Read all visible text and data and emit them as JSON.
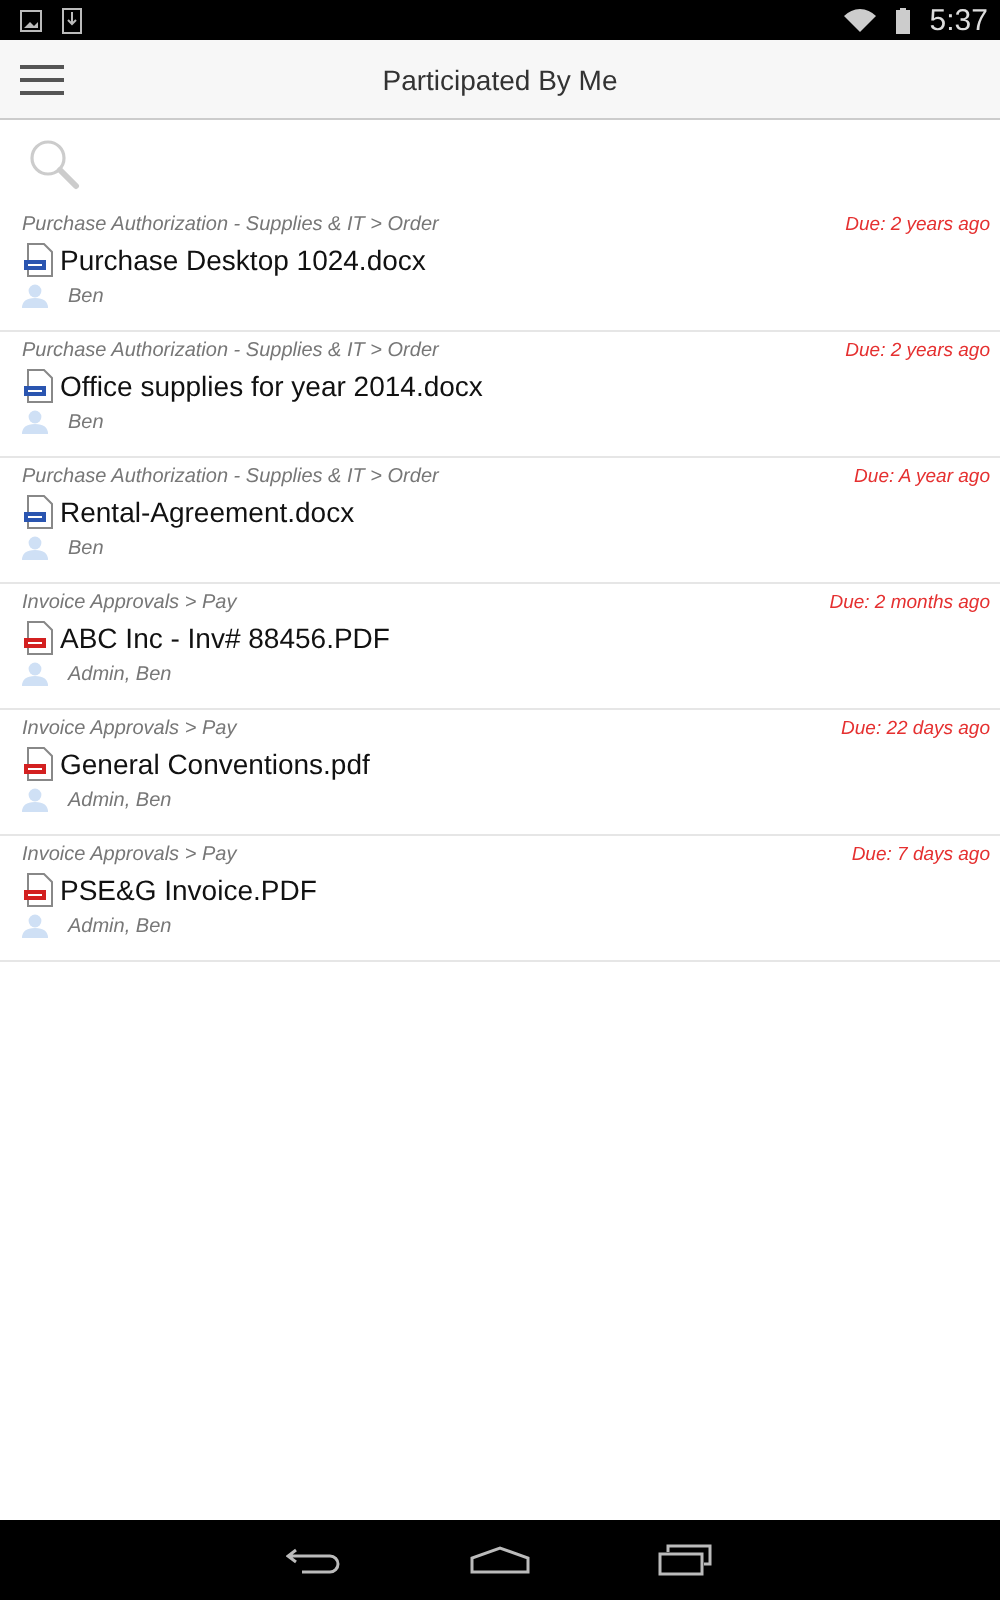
{
  "status_bar": {
    "time": "5:37"
  },
  "toolbar": {
    "title": "Participated By Me"
  },
  "items": [
    {
      "path": "Purchase Authorization - Supplies & IT > Order",
      "due": "Due: 2 years ago",
      "kind": "docx",
      "name": "Purchase Desktop 1024.docx",
      "people": "Ben"
    },
    {
      "path": "Purchase Authorization - Supplies & IT > Order",
      "due": "Due: 2 years ago",
      "kind": "docx",
      "name": "Office supplies for year 2014.docx",
      "people": "Ben"
    },
    {
      "path": "Purchase Authorization - Supplies & IT > Order",
      "due": "Due: A year ago",
      "kind": "docx",
      "name": "Rental-Agreement.docx",
      "people": "Ben"
    },
    {
      "path": "Invoice Approvals > Pay",
      "due": "Due: 2 months ago",
      "kind": "pdf",
      "name": "ABC Inc - Inv# 88456.PDF",
      "people": "Admin, Ben"
    },
    {
      "path": "Invoice Approvals > Pay",
      "due": "Due: 22 days ago",
      "kind": "pdf",
      "name": "General Conventions.pdf",
      "people": "Admin, Ben"
    },
    {
      "path": "Invoice Approvals > Pay",
      "due": "Due: 7 days ago",
      "kind": "pdf",
      "name": "PSE&G Invoice.PDF",
      "people": "Admin, Ben"
    }
  ]
}
